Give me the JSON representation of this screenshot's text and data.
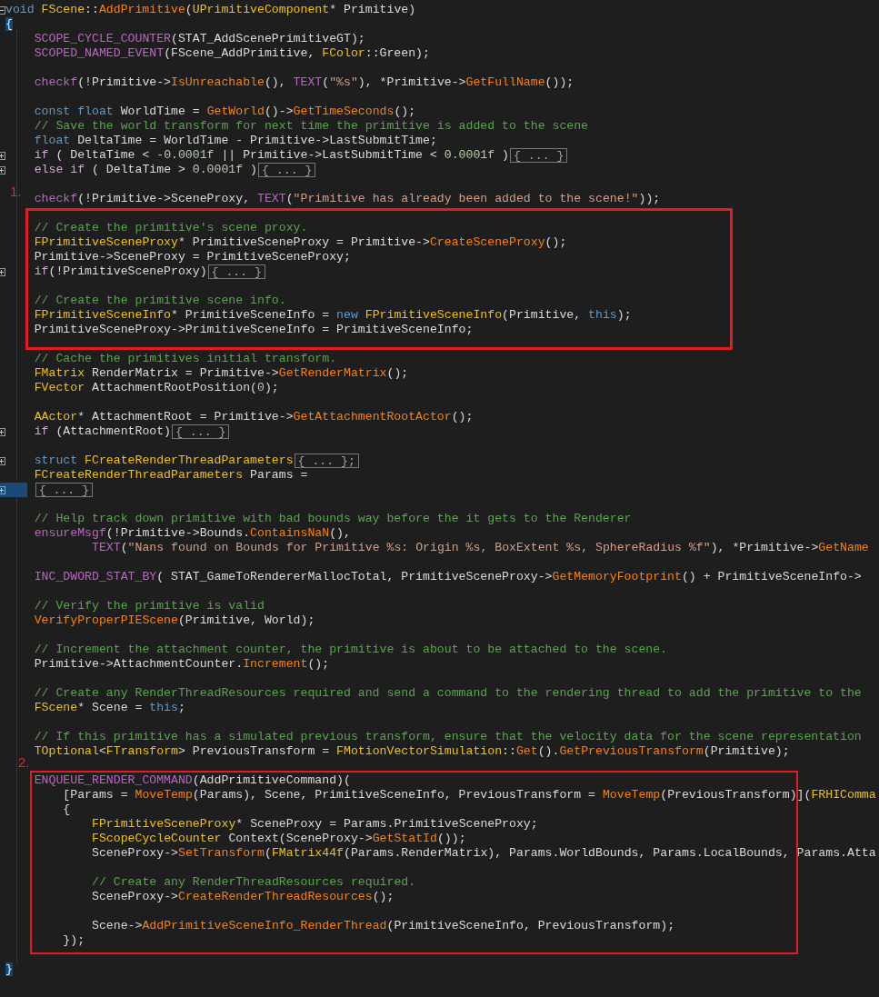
{
  "blocks": [
    {
      "kind": "plain",
      "lines": [
        {
          "kind": "code",
          "folded": false,
          "tokens": [
            {
              "text": "void ",
              "kind": "keyword"
            },
            {
              "text": "FScene",
              "kind": "type"
            },
            {
              "text": "::",
              "kind": "plain"
            },
            {
              "text": "AddPrimitive",
              "kind": "func"
            },
            {
              "text": "(",
              "kind": "plain"
            },
            {
              "text": "UPrimitiveComponent",
              "kind": "type"
            },
            {
              "text": "* Primitive)",
              "kind": "plain"
            }
          ]
        },
        {
          "kind": "code",
          "tokens": [
            {
              "text": "{",
              "kind": "brace-match"
            }
          ]
        },
        {
          "kind": "group",
          "children": [
            {
              "kind": "code",
              "tokens": [
                {
                  "text": "SCOPE_CYCLE_COUNTER",
                  "kind": "macro"
                },
                {
                  "text": "(STAT_AddScenePrimitiveGT);",
                  "kind": "plain"
                }
              ]
            },
            {
              "kind": "code",
              "tokens": [
                {
                  "text": "SCOPED_NAMED_EVENT",
                  "kind": "macro"
                },
                {
                  "text": "(FScene_AddPrimitive, ",
                  "kind": "plain"
                },
                {
                  "text": "FColor",
                  "kind": "type"
                },
                {
                  "text": "::Green);",
                  "kind": "plain"
                }
              ]
            },
            {
              "kind": "blank"
            },
            {
              "kind": "code",
              "tokens": [
                {
                  "text": "checkf",
                  "kind": "macro"
                },
                {
                  "text": "(!Primitive->",
                  "kind": "plain"
                },
                {
                  "text": "IsUnreachable",
                  "kind": "func"
                },
                {
                  "text": "(), ",
                  "kind": "plain"
                },
                {
                  "text": "TEXT",
                  "kind": "macro"
                },
                {
                  "text": "(",
                  "kind": "plain"
                },
                {
                  "text": "\"%s\"",
                  "kind": "string"
                },
                {
                  "text": "), *Primitive->",
                  "kind": "plain"
                },
                {
                  "text": "GetFullName",
                  "kind": "func"
                },
                {
                  "text": "());",
                  "kind": "plain"
                }
              ]
            },
            {
              "kind": "blank"
            },
            {
              "kind": "code",
              "tokens": [
                {
                  "text": "const float",
                  "kind": "keyword"
                },
                {
                  "text": " WorldTime = ",
                  "kind": "plain"
                },
                {
                  "text": "GetWorld",
                  "kind": "func"
                },
                {
                  "text": "()->",
                  "kind": "plain"
                },
                {
                  "text": "GetTimeSeconds",
                  "kind": "func"
                },
                {
                  "text": "();",
                  "kind": "plain"
                }
              ]
            },
            {
              "kind": "code",
              "tokens": [
                {
                  "text": "// Save the world transform for next time the primitive is added to the scene",
                  "kind": "comment"
                }
              ]
            },
            {
              "kind": "code",
              "tokens": [
                {
                  "text": "float",
                  "kind": "keyword"
                },
                {
                  "text": " DeltaTime = WorldTime - Primitive->LastSubmitTime;",
                  "kind": "plain"
                }
              ]
            },
            {
              "kind": "code",
              "folded": true,
              "collapsed_text": "{ ... }",
              "tokens": [
                {
                  "text": "if",
                  "kind": "control"
                },
                {
                  "text": " ( DeltaTime < ",
                  "kind": "plain"
                },
                {
                  "text": "-0.0001f",
                  "kind": "number"
                },
                {
                  "text": " || Primitive->LastSubmitTime < ",
                  "kind": "plain"
                },
                {
                  "text": "0.0001f",
                  "kind": "number"
                },
                {
                  "text": " )",
                  "kind": "plain"
                }
              ]
            },
            {
              "kind": "code",
              "folded": true,
              "collapsed_text": "{ ... }",
              "tokens": [
                {
                  "text": "else if",
                  "kind": "control"
                },
                {
                  "text": " ( DeltaTime > ",
                  "kind": "plain"
                },
                {
                  "text": "0.0001f",
                  "kind": "number"
                },
                {
                  "text": " )",
                  "kind": "plain"
                }
              ]
            },
            {
              "kind": "blank"
            },
            {
              "kind": "code",
              "tokens": [
                {
                  "text": "checkf",
                  "kind": "macro"
                },
                {
                  "text": "(!Primitive->SceneProxy, ",
                  "kind": "plain"
                },
                {
                  "text": "TEXT",
                  "kind": "macro"
                },
                {
                  "text": "(",
                  "kind": "plain"
                },
                {
                  "text": "\"Primitive has already been added to the scene!\"",
                  "kind": "string"
                },
                {
                  "text": "));",
                  "kind": "plain"
                }
              ]
            }
          ]
        }
      ]
    },
    {
      "kind": "annotated",
      "label": "1.",
      "lines": [
        {
          "kind": "blank"
        },
        {
          "kind": "group",
          "children": [
            {
              "kind": "code",
              "tokens": [
                {
                  "text": "// Create the primitive's scene proxy.",
                  "kind": "comment"
                }
              ]
            },
            {
              "kind": "code",
              "tokens": [
                {
                  "text": "FPrimitiveSceneProxy",
                  "kind": "type"
                },
                {
                  "text": "* PrimitiveSceneProxy = Primitive->",
                  "kind": "plain"
                },
                {
                  "text": "CreateSceneProxy",
                  "kind": "func"
                },
                {
                  "text": "();",
                  "kind": "plain"
                }
              ]
            },
            {
              "kind": "code",
              "tokens": [
                {
                  "text": "Primitive->SceneProxy = PrimitiveSceneProxy;",
                  "kind": "plain"
                }
              ]
            },
            {
              "kind": "code",
              "folded": true,
              "collapsed_text": "{ ... }",
              "tokens": [
                {
                  "text": "if",
                  "kind": "control"
                },
                {
                  "text": "(!PrimitiveSceneProxy)",
                  "kind": "plain"
                }
              ]
            },
            {
              "kind": "blank"
            },
            {
              "kind": "code",
              "tokens": [
                {
                  "text": "// Create the primitive scene info.",
                  "kind": "comment"
                }
              ]
            },
            {
              "kind": "code",
              "tokens": [
                {
                  "text": "FPrimitiveSceneInfo",
                  "kind": "type"
                },
                {
                  "text": "* PrimitiveSceneInfo = ",
                  "kind": "plain"
                },
                {
                  "text": "new ",
                  "kind": "keyword"
                },
                {
                  "text": "FPrimitiveSceneInfo",
                  "kind": "type"
                },
                {
                  "text": "(Primitive, ",
                  "kind": "plain"
                },
                {
                  "text": "this",
                  "kind": "keyword"
                },
                {
                  "text": ");",
                  "kind": "plain"
                }
              ]
            },
            {
              "kind": "code",
              "tokens": [
                {
                  "text": "PrimitiveSceneProxy->PrimitiveSceneInfo = PrimitiveSceneInfo;",
                  "kind": "plain"
                }
              ]
            }
          ]
        },
        {
          "kind": "blank"
        }
      ]
    },
    {
      "kind": "plain",
      "lines": [
        {
          "kind": "group",
          "children": [
            {
              "kind": "code",
              "tokens": [
                {
                  "text": "// Cache the primitives initial transform.",
                  "kind": "comment"
                }
              ]
            },
            {
              "kind": "code",
              "tokens": [
                {
                  "text": "FMatrix",
                  "kind": "type"
                },
                {
                  "text": " RenderMatrix = Primitive->",
                  "kind": "plain"
                },
                {
                  "text": "GetRenderMatrix",
                  "kind": "func"
                },
                {
                  "text": "();",
                  "kind": "plain"
                }
              ]
            },
            {
              "kind": "code",
              "tokens": [
                {
                  "text": "FVector",
                  "kind": "type"
                },
                {
                  "text": " AttachmentRootPosition(",
                  "kind": "plain"
                },
                {
                  "text": "0",
                  "kind": "number"
                },
                {
                  "text": ");",
                  "kind": "plain"
                }
              ]
            },
            {
              "kind": "blank"
            },
            {
              "kind": "code",
              "tokens": [
                {
                  "text": "AActor",
                  "kind": "type"
                },
                {
                  "text": "* AttachmentRoot = Primitive->",
                  "kind": "plain"
                },
                {
                  "text": "GetAttachmentRootActor",
                  "kind": "func"
                },
                {
                  "text": "();",
                  "kind": "plain"
                }
              ]
            },
            {
              "kind": "code",
              "folded": true,
              "collapsed_text": "{ ... }",
              "tokens": [
                {
                  "text": "if",
                  "kind": "control"
                },
                {
                  "text": " (AttachmentRoot)",
                  "kind": "plain"
                }
              ]
            },
            {
              "kind": "blank"
            },
            {
              "kind": "code",
              "folded": true,
              "collapsed_text": "{ ... };",
              "tokens": [
                {
                  "text": "struct ",
                  "kind": "keyword"
                },
                {
                  "text": "FCreateRenderThreadParameters",
                  "kind": "type"
                }
              ]
            },
            {
              "kind": "code",
              "tokens": [
                {
                  "text": "FCreateRenderThreadParameters",
                  "kind": "type"
                },
                {
                  "text": " Params =",
                  "kind": "plain"
                }
              ]
            },
            {
              "kind": "code",
              "folded": true,
              "current": true,
              "collapsed_text": "{ ... }"
            },
            {
              "kind": "blank"
            },
            {
              "kind": "code",
              "tokens": [
                {
                  "text": "// Help track down primitive with bad bounds way before the it gets to the Renderer",
                  "kind": "comment"
                }
              ]
            },
            {
              "kind": "code",
              "tokens": [
                {
                  "text": "ensureMsgf",
                  "kind": "macro"
                },
                {
                  "text": "(!Primitive->Bounds.",
                  "kind": "plain"
                },
                {
                  "text": "ContainsNaN",
                  "kind": "func"
                },
                {
                  "text": "(),",
                  "kind": "plain"
                }
              ]
            },
            {
              "kind": "group",
              "children": [
                {
                  "kind": "group",
                  "children": [
                    {
                      "kind": "code",
                      "tokens": [
                        {
                          "text": "TEXT",
                          "kind": "macro"
                        },
                        {
                          "text": "(",
                          "kind": "plain"
                        },
                        {
                          "text": "\"Nans found on Bounds for Primitive %s: Origin %s, BoxExtent %s, SphereRadius %f\"",
                          "kind": "string"
                        },
                        {
                          "text": "), *Primitive->",
                          "kind": "plain"
                        },
                        {
                          "text": "GetName",
                          "kind": "func"
                        }
                      ]
                    }
                  ]
                }
              ]
            },
            {
              "kind": "blank"
            },
            {
              "kind": "code",
              "tokens": [
                {
                  "text": "INC_DWORD_STAT_BY",
                  "kind": "macro"
                },
                {
                  "text": "( STAT_GameToRendererMallocTotal, PrimitiveSceneProxy->",
                  "kind": "plain"
                },
                {
                  "text": "GetMemoryFootprint",
                  "kind": "func"
                },
                {
                  "text": "() + PrimitiveSceneInfo->",
                  "kind": "plain"
                }
              ]
            },
            {
              "kind": "blank"
            },
            {
              "kind": "code",
              "tokens": [
                {
                  "text": "// Verify the primitive is valid",
                  "kind": "comment"
                }
              ]
            },
            {
              "kind": "code",
              "tokens": [
                {
                  "text": "VerifyProperPIEScene",
                  "kind": "func"
                },
                {
                  "text": "(Primitive, World);",
                  "kind": "plain"
                }
              ]
            },
            {
              "kind": "blank"
            },
            {
              "kind": "code",
              "tokens": [
                {
                  "text": "// Increment the attachment counter, the primitive is about to be attached to the scene.",
                  "kind": "comment"
                }
              ]
            },
            {
              "kind": "code",
              "tokens": [
                {
                  "text": "Primitive->AttachmentCounter.",
                  "kind": "plain"
                },
                {
                  "text": "Increment",
                  "kind": "func"
                },
                {
                  "text": "();",
                  "kind": "plain"
                }
              ]
            },
            {
              "kind": "blank"
            },
            {
              "kind": "code",
              "tokens": [
                {
                  "text": "// Create any RenderThreadResources required and send a command to the rendering thread to add the primitive to the",
                  "kind": "comment"
                }
              ]
            },
            {
              "kind": "code",
              "tokens": [
                {
                  "text": "FScene",
                  "kind": "type"
                },
                {
                  "text": "* Scene = ",
                  "kind": "plain"
                },
                {
                  "text": "this",
                  "kind": "keyword"
                },
                {
                  "text": ";",
                  "kind": "plain"
                }
              ]
            },
            {
              "kind": "blank"
            },
            {
              "kind": "code",
              "tokens": [
                {
                  "text": "// If this primitive has a simulated previous transform, ensure that the velocity data for the scene representation",
                  "kind": "comment"
                }
              ]
            },
            {
              "kind": "code",
              "tokens": [
                {
                  "text": "TOptional",
                  "kind": "type"
                },
                {
                  "text": "<",
                  "kind": "plain"
                },
                {
                  "text": "FTransform",
                  "kind": "type"
                },
                {
                  "text": "> PreviousTransform = ",
                  "kind": "plain"
                },
                {
                  "text": "FMotionVectorSimulation",
                  "kind": "type"
                },
                {
                  "text": "::",
                  "kind": "plain"
                },
                {
                  "text": "Get",
                  "kind": "func"
                },
                {
                  "text": "().",
                  "kind": "plain"
                },
                {
                  "text": "GetPreviousTransform",
                  "kind": "func"
                },
                {
                  "text": "(Primitive);",
                  "kind": "plain"
                }
              ]
            }
          ]
        },
        {
          "kind": "blank"
        }
      ]
    },
    {
      "kind": "annotated",
      "label": "2.",
      "lines": [
        {
          "kind": "group",
          "children": [
            {
              "kind": "code",
              "tokens": [
                {
                  "text": "ENQUEUE_RENDER_COMMAND",
                  "kind": "macro"
                },
                {
                  "text": "(AddPrimitiveCommand)(",
                  "kind": "plain"
                }
              ]
            },
            {
              "kind": "group",
              "children": [
                {
                  "kind": "code",
                  "tokens": [
                    {
                      "text": "[Params = ",
                      "kind": "plain"
                    },
                    {
                      "text": "MoveTemp",
                      "kind": "func"
                    },
                    {
                      "text": "(Params), Scene, PrimitiveSceneInfo, PreviousTransform = ",
                      "kind": "plain"
                    },
                    {
                      "text": "MoveTemp",
                      "kind": "func"
                    },
                    {
                      "text": "(PreviousTransform)](",
                      "kind": "plain"
                    },
                    {
                      "text": "FRHIComma",
                      "kind": "type"
                    }
                  ]
                },
                {
                  "kind": "code",
                  "tokens": [
                    {
                      "text": "{",
                      "kind": "plain"
                    }
                  ]
                },
                {
                  "kind": "group",
                  "children": [
                    {
                      "kind": "code",
                      "tokens": [
                        {
                          "text": "FPrimitiveSceneProxy",
                          "kind": "type"
                        },
                        {
                          "text": "* SceneProxy = Params.PrimitiveSceneProxy;",
                          "kind": "plain"
                        }
                      ]
                    },
                    {
                      "kind": "code",
                      "tokens": [
                        {
                          "text": "FScopeCycleCounter",
                          "kind": "type"
                        },
                        {
                          "text": " Context(SceneProxy->",
                          "kind": "plain"
                        },
                        {
                          "text": "GetStatId",
                          "kind": "func"
                        },
                        {
                          "text": "());",
                          "kind": "plain"
                        }
                      ]
                    },
                    {
                      "kind": "code",
                      "tokens": [
                        {
                          "text": "SceneProxy->",
                          "kind": "plain"
                        },
                        {
                          "text": "SetTransform",
                          "kind": "func"
                        },
                        {
                          "text": "(",
                          "kind": "plain"
                        },
                        {
                          "text": "FMatrix44f",
                          "kind": "type"
                        },
                        {
                          "text": "(Params.RenderMatrix), Params.WorldBounds, Params.LocalBounds, Params.Atta",
                          "kind": "plain"
                        }
                      ]
                    },
                    {
                      "kind": "blank"
                    },
                    {
                      "kind": "code",
                      "tokens": [
                        {
                          "text": "// Create any RenderThreadResources required.",
                          "kind": "comment"
                        }
                      ]
                    },
                    {
                      "kind": "code",
                      "tokens": [
                        {
                          "text": "SceneProxy->",
                          "kind": "plain"
                        },
                        {
                          "text": "CreateRenderThreadResources",
                          "kind": "func"
                        },
                        {
                          "text": "();",
                          "kind": "plain"
                        }
                      ]
                    },
                    {
                      "kind": "blank"
                    },
                    {
                      "kind": "code",
                      "tokens": [
                        {
                          "text": "Scene->",
                          "kind": "plain"
                        },
                        {
                          "text": "AddPrimitiveSceneInfo_RenderThread",
                          "kind": "func"
                        },
                        {
                          "text": "(PrimitiveSceneInfo, PreviousTransform);",
                          "kind": "plain"
                        }
                      ]
                    }
                  ]
                },
                {
                  "kind": "code",
                  "tokens": [
                    {
                      "text": "});",
                      "kind": "plain"
                    }
                  ]
                }
              ]
            }
          ]
        }
      ]
    },
    {
      "kind": "plain",
      "lines": [
        {
          "kind": "blank"
        },
        {
          "kind": "code",
          "tokens": [
            {
              "text": "}",
              "kind": "brace-match"
            }
          ]
        }
      ]
    }
  ]
}
